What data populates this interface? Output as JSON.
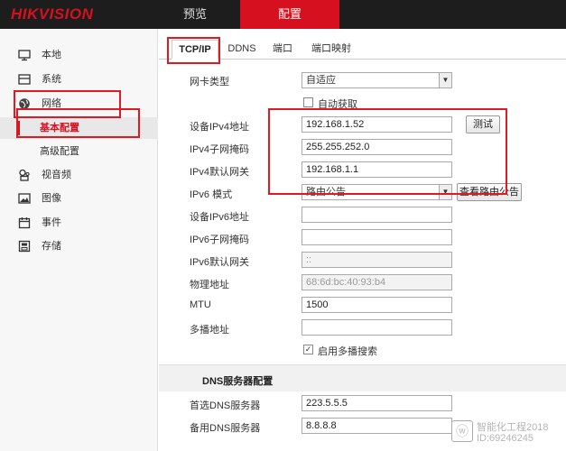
{
  "header": {
    "logo": "HIKVISION",
    "nav": [
      "预览",
      "配置"
    ],
    "active": "配置"
  },
  "sidebar": {
    "items": [
      {
        "label": "本地",
        "icon": "monitor-icon"
      },
      {
        "label": "系统",
        "icon": "system-icon"
      },
      {
        "label": "网络",
        "icon": "globe-icon"
      },
      {
        "label": "基本配置",
        "icon": "",
        "sub": true,
        "active": true
      },
      {
        "label": "高级配置",
        "icon": "",
        "sub": true
      },
      {
        "label": "视音频",
        "icon": "audio-video-icon"
      },
      {
        "label": "图像",
        "icon": "image-icon"
      },
      {
        "label": "事件",
        "icon": "calendar-icon"
      },
      {
        "label": "存储",
        "icon": "storage-icon"
      }
    ]
  },
  "tabs": [
    "TCP/IP",
    "DDNS",
    "端口",
    "端口映射"
  ],
  "form": {
    "nic_type_label": "网卡类型",
    "nic_type_value": "自适应",
    "dhcp_label": "自动获取",
    "dhcp_checked": false,
    "ipv4_addr_label": "设备IPv4地址",
    "ipv4_addr": "192.168.1.52",
    "test_button": "测试",
    "ipv4_mask_label": "IPv4子网掩码",
    "ipv4_mask": "255.255.252.0",
    "ipv4_gw_label": "IPv4默认网关",
    "ipv4_gw": "192.168.1.1",
    "ipv6_mode_label": "IPv6 模式",
    "ipv6_mode_value": "路由公告",
    "view_route_button": "查看路由公告",
    "ipv6_addr_label": "设备IPv6地址",
    "ipv6_addr": "",
    "ipv6_prefix_label": "IPv6子网掩码",
    "ipv6_prefix": "",
    "ipv6_gw_label": "IPv6默认网关",
    "ipv6_gw": "::",
    "mac_label": "物理地址",
    "mac": "68:6d:bc:40:93:b4",
    "mtu_label": "MTU",
    "mtu": "1500",
    "multicast_label": "多播地址",
    "multicast": "",
    "multicast_search_label": "启用多播搜索",
    "multicast_search_checked": true,
    "dns_section_title": "DNS服务器配置",
    "dns1_label": "首选DNS服务器",
    "dns1": "223.5.5.5",
    "dns2_label": "备用DNS服务器",
    "dns2": "8.8.8.8"
  },
  "watermark": {
    "line1": "智能化工程2018",
    "line2": "ID:69246245"
  },
  "colors": {
    "brand_red": "#d7101f",
    "annotation_red": "#e01a22",
    "topbar": "#1d1d1d"
  }
}
